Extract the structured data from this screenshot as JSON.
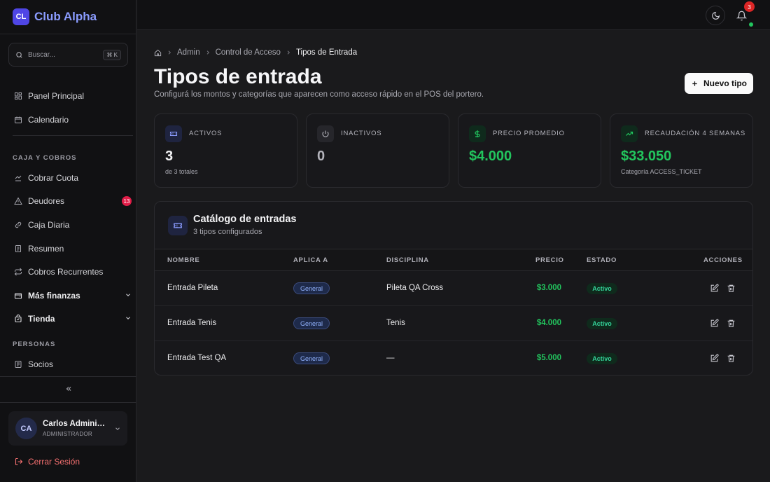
{
  "brand": {
    "logo": "CL",
    "name": "Club Alpha"
  },
  "search": {
    "placeholder": "Buscar...",
    "shortcut": "⌘ K"
  },
  "sidebar": {
    "top_items": [
      {
        "label": "Panel Principal",
        "icon": "dashboard-icon"
      },
      {
        "label": "Calendario",
        "icon": "calendar-icon"
      }
    ],
    "caja_section": "CAJA Y COBROS",
    "caja_items": [
      {
        "label": "Cobrar Cuota",
        "icon": "card-icon"
      },
      {
        "label": "Deudores",
        "icon": "alert-icon",
        "badge": "13"
      },
      {
        "label": "Caja Diaria",
        "icon": "wallet-icon"
      },
      {
        "label": "Resumen",
        "icon": "receipt-icon"
      },
      {
        "label": "Cobros Recurrentes",
        "icon": "repeat-icon"
      }
    ],
    "groups": [
      {
        "label": "Más finanzas",
        "icon": "wallet-icon"
      },
      {
        "label": "Tienda",
        "icon": "bag-icon"
      }
    ],
    "personas_section": "PERSONAS",
    "personas_items": [
      {
        "label": "Socios",
        "icon": "id-card-icon"
      }
    ]
  },
  "user": {
    "initials": "CA",
    "name": "Carlos Administrador",
    "role": "ADMINISTRADOR"
  },
  "logout_label": "Cerrar Sesión",
  "topbar": {
    "notifications": "3"
  },
  "breadcrumb": [
    "Admin",
    "Control de Acceso",
    "Tipos de Entrada"
  ],
  "page": {
    "title": "Tipos de entrada",
    "subtitle": "Configurá los montos y categorías que aparecen como acceso rápido en el POS del portero.",
    "new_button": "Nuevo tipo"
  },
  "stats": [
    {
      "label": "ACTIVOS",
      "value": "3",
      "sub": "de 3 totales",
      "icon": "ticket-icon",
      "value_color": "#f2f2f4"
    },
    {
      "label": "INACTIVOS",
      "value": "0",
      "sub": "",
      "icon": "power-icon",
      "value_color": "#b4b4bc"
    },
    {
      "label": "PRECIO PROMEDIO",
      "value": "$4.000",
      "sub": "",
      "icon": "dollar-icon",
      "value_color": "#22c55e"
    },
    {
      "label": "RECAUDACIÓN 4 SEMANAS",
      "value": "$33.050",
      "sub": "Categoría ACCESS_TICKET",
      "icon": "trending-up-icon",
      "value_color": "#22c55e"
    }
  ],
  "catalog": {
    "title": "Catálogo de entradas",
    "subtitle": "3 tipos configurados",
    "columns": [
      "NOMBRE",
      "APLICA A",
      "DISCIPLINA",
      "PRECIO",
      "ESTADO",
      "ACCIONES"
    ],
    "rows": [
      {
        "name": "Entrada Pileta",
        "applies": "General",
        "discipline": "Pileta QA Cross",
        "price": "$3.000",
        "status": "Activo"
      },
      {
        "name": "Entrada Tenis",
        "applies": "General",
        "discipline": "Tenis",
        "price": "$4.000",
        "status": "Activo"
      },
      {
        "name": "Entrada Test QA",
        "applies": "General",
        "discipline": "—",
        "price": "$5.000",
        "status": "Activo"
      }
    ]
  }
}
